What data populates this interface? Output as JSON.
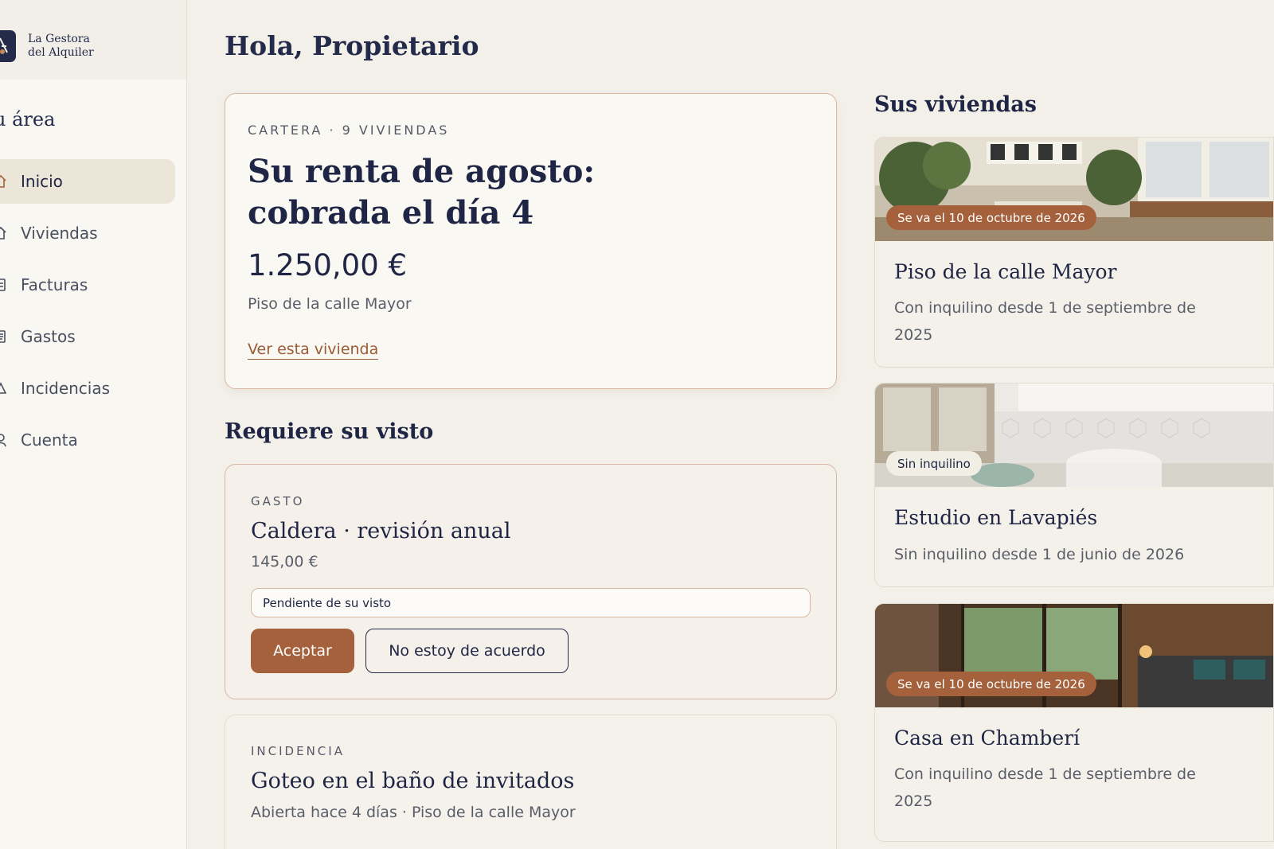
{
  "brand": {
    "line1": "La Gestora",
    "line2": "del Alquiler"
  },
  "sidebar": {
    "title": "u área",
    "items": [
      {
        "label": "Inicio",
        "icon": "home-icon",
        "active": true
      },
      {
        "label": "Viviendas",
        "icon": "house-icon",
        "active": false
      },
      {
        "label": "Facturas",
        "icon": "invoice-icon",
        "active": false
      },
      {
        "label": "Gastos",
        "icon": "receipt-icon",
        "active": false
      },
      {
        "label": "Incidencias",
        "icon": "warning-icon",
        "active": false
      },
      {
        "label": "Cuenta",
        "icon": "user-icon",
        "active": false
      }
    ]
  },
  "greeting": "Hola, Propietario",
  "hero": {
    "eyebrow": "CARTERA · 9 VIVIENDAS",
    "title": "Su renta de agosto: cobrada el día 4",
    "amount": "1.250,00 €",
    "property": "Piso de la calle Mayor",
    "link": "Ver esta vivienda"
  },
  "review": {
    "title": "Requiere su visto",
    "gasto": {
      "eyebrow": "GASTO",
      "title": "Caldera · revisión anual",
      "price": "145,00 €",
      "status": "Pendiente de su visto",
      "accept_label": "Aceptar",
      "disagree_label": "No estoy de acuerdo"
    },
    "incidencia": {
      "eyebrow": "INCIDENCIA",
      "title": "Goteo en el baño de invitados",
      "meta": "Abierta hace 4 días · Piso de la calle Mayor"
    }
  },
  "properties": {
    "title": "Sus viviendas",
    "items": [
      {
        "badge": "Se va el 10 de octubre de 2026",
        "name": "Piso de la calle Mayor",
        "desc": "Con inquilino desde 1 de septiembre de 2025"
      },
      {
        "badge": "Sin inquilino",
        "name": "Estudio en Lavapiés",
        "desc": "Sin inquilino desde 1 de junio de 2026"
      },
      {
        "badge": "Se va el 10 de octubre de 2026",
        "name": "Casa en Chamberí",
        "desc": "Con inquilino desde 1 de septiembre de 2025"
      }
    ]
  },
  "colors": {
    "accent": "#a5613b",
    "navy": "#1f2544",
    "background": "#f2f0e9"
  }
}
